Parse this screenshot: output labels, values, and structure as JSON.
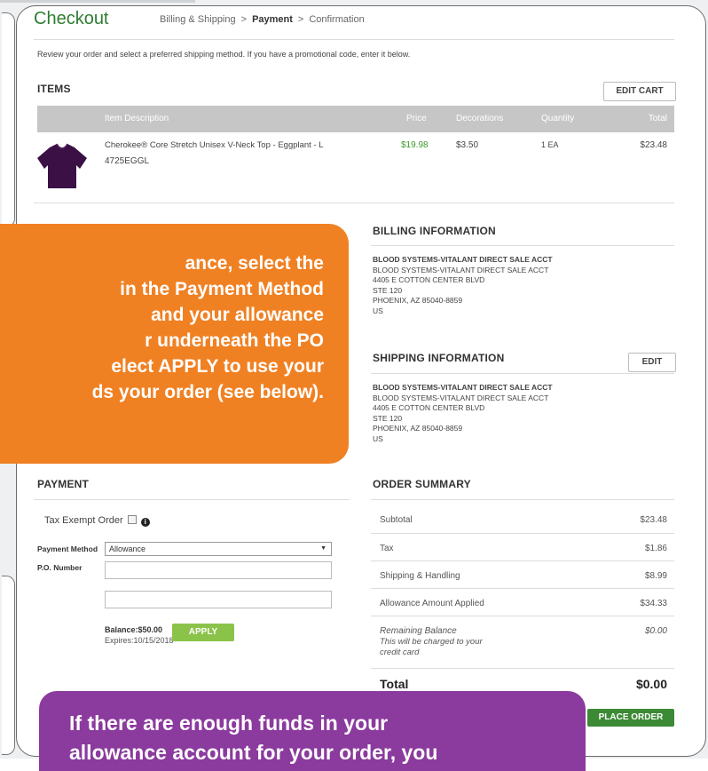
{
  "header": {
    "title": "Checkout",
    "breadcrumb": [
      "Billing & Shipping",
      "Payment",
      "Confirmation"
    ],
    "breadcrumb_sep": ">"
  },
  "intro": "Review your order and select a preferred shipping method. If you have a promotional code, enter it below.",
  "items": {
    "heading": "ITEMS",
    "edit_cart": "EDIT CART",
    "columns": [
      "Item Description",
      "Price",
      "Decorations",
      "Quantity",
      "Total"
    ],
    "rows": [
      {
        "name": "Cherokee® Core Stretch Unisex V-Neck Top - Eggplant - L",
        "sku": "4725EGGL",
        "price": "$19.98",
        "decorations": "$3.50",
        "quantity": "1 EA",
        "total": "$23.48"
      }
    ]
  },
  "billing": {
    "heading": "BILLING INFORMATION",
    "lines": [
      "BLOOD SYSTEMS-VITALANT DIRECT SALE ACCT",
      "BLOOD SYSTEMS-VITALANT DIRECT SALE ACCT",
      "4405 E COTTON CENTER BLVD",
      "STE 120",
      "PHOENIX, AZ 85040-8859",
      "US"
    ]
  },
  "shipping": {
    "heading": "SHIPPING INFORMATION",
    "edit": "EDIT",
    "lines": [
      "BLOOD SYSTEMS-VITALANT DIRECT SALE ACCT",
      "BLOOD SYSTEMS-VITALANT DIRECT SALE ACCT",
      "4405 E COTTON CENTER BLVD",
      "STE 120",
      "PHOENIX, AZ 85040-8859",
      "US"
    ]
  },
  "payment": {
    "heading": "PAYMENT",
    "tax_exempt_label": "Tax Exempt Order",
    "tax_exempt_checked": false,
    "payment_method_label": "Payment Method",
    "payment_method_value": "Allowance",
    "po_label": "P.O. Number",
    "po_value": "",
    "balance": "Balance:$50.00",
    "expires": "Expires:10/15/2018",
    "apply": "APPLY"
  },
  "summary": {
    "heading": "ORDER SUMMARY",
    "rows": [
      {
        "label": "Subtotal",
        "value": "$23.48"
      },
      {
        "label": "Tax",
        "value": "$1.86"
      },
      {
        "label": "Shipping & Handling",
        "value": "$8.99"
      },
      {
        "label": "Allowance Amount Applied",
        "value": "$34.33"
      }
    ],
    "remaining_label": "Remaining Balance",
    "remaining_note_1": "This will be charged to your",
    "remaining_note_2": "credit card",
    "remaining_value": "$0.00",
    "total_label": "Total",
    "total_value": "$0.00",
    "place_order": "PLACE ORDER"
  },
  "callouts": {
    "orange_lines": [
      "ance, select the",
      "in the Payment Method",
      "and your allowance",
      "r underneath the PO",
      "elect APPLY to use your",
      "ds your order (see below)."
    ],
    "purple_lines": [
      "If there are enough funds in your",
      "allowance account for your order, you"
    ]
  },
  "colors": {
    "brand_green": "#2e7d32",
    "apply_green": "#8bc34a",
    "place_order_green": "#3c8a35",
    "orange": "#f08123",
    "purple": "#8b3a9e",
    "product": "#3a1045"
  },
  "icons": {
    "info": "info-circle-icon",
    "dropdown": "chevron-down-icon",
    "checkbox": "checkbox-icon"
  }
}
